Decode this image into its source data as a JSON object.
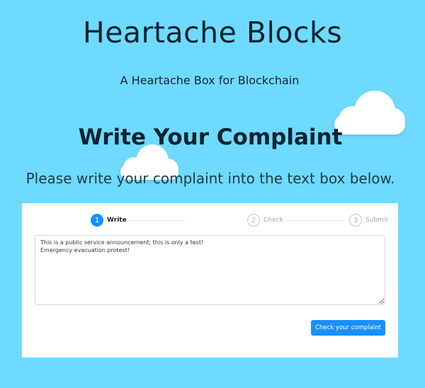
{
  "header": {
    "title": "Heartache Blocks",
    "subtitle": "A Heartache Box for Blockchain"
  },
  "main": {
    "heading": "Write Your Complaint",
    "instructions": "Please write your complaint into the text box below."
  },
  "steps": [
    {
      "number": "1",
      "label": "Write",
      "status": "active"
    },
    {
      "number": "2",
      "label": "Check",
      "status": "wait"
    },
    {
      "number": "3",
      "label": "Submit",
      "status": "wait"
    }
  ],
  "complaint": {
    "value": "This is a public service announcement; this is only a test!\nEmergency evacuation protest!"
  },
  "actions": {
    "check_label": "Check your complaint"
  },
  "colors": {
    "background": "#6fdaff",
    "accent": "#1890ff",
    "card": "#ffffff"
  }
}
